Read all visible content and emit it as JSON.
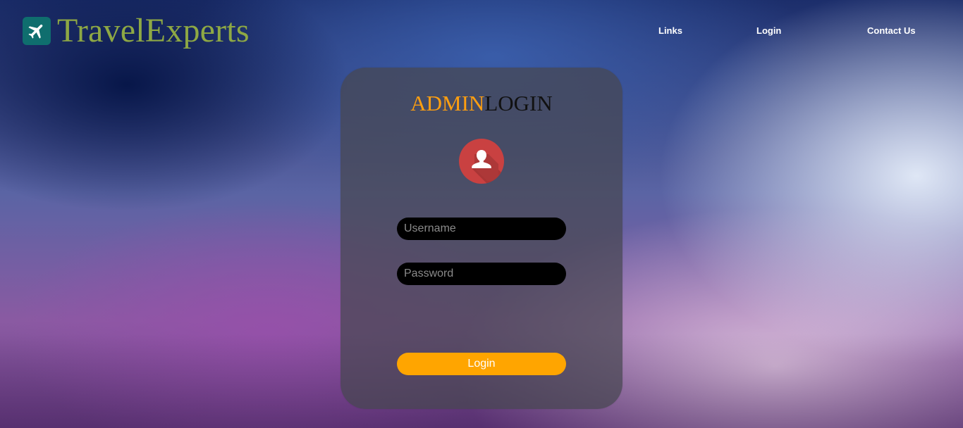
{
  "brand": {
    "name": "TravelExperts",
    "icon": "airplane-icon",
    "icon_bg": "#0f6e6e",
    "name_color": "#8ea844"
  },
  "nav": {
    "links_label": "Links",
    "login_label": "Login",
    "contact_label": "Contact Us"
  },
  "card": {
    "title_part1": "ADMIN",
    "title_part2": "LOGIN",
    "title_part1_color": "#ff9f10",
    "title_part2_color": "#111111",
    "avatar_icon": "user-icon",
    "avatar_color": "#c94141"
  },
  "form": {
    "username_placeholder": "Username",
    "password_placeholder": "Password",
    "submit_label": "Login",
    "submit_color": "#ffa500"
  }
}
